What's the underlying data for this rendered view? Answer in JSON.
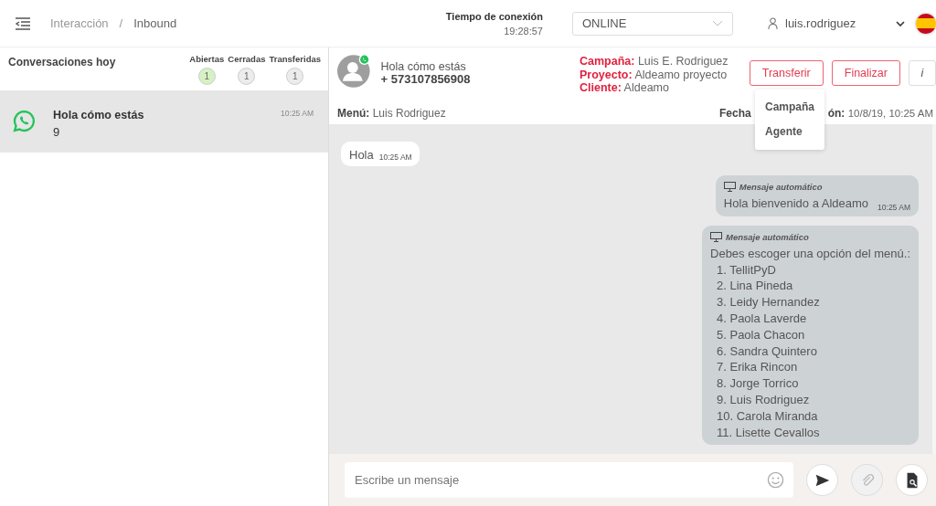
{
  "breadcrumb": [
    "Interacción",
    "/",
    "Inbound"
  ],
  "connection": {
    "label": "Tiempo de conexión",
    "time": "19:28:57"
  },
  "status_select": {
    "value": "ONLINE"
  },
  "user": {
    "name": "luis.rodriguez"
  },
  "conversations": {
    "title": "Conversaciones hoy",
    "counters": [
      {
        "label": "Abiertas",
        "count": "1",
        "color": "#d6f2c4"
      },
      {
        "label": "Cerradas",
        "count": "1",
        "color": "#ececec"
      },
      {
        "label": "Transferidas",
        "count": "1",
        "color": "#ececec"
      }
    ],
    "items": [
      {
        "title": "Hola cómo estás",
        "subtitle": "9",
        "time": "10:25 AM",
        "selected": true
      }
    ]
  },
  "contact": {
    "name": "Hola cómo estás",
    "phone": "+ 573107856908"
  },
  "details": [
    {
      "label": "Campaña:",
      "value": "Luis E. Rodriguez"
    },
    {
      "label": "Proyecto:",
      "value": "Aldeamo proyecto"
    },
    {
      "label": "Cliente:",
      "value": "Aldeamo"
    }
  ],
  "actions": [
    {
      "label": "Transferir",
      "kind": "outline"
    },
    {
      "label": "Finalizar",
      "kind": "outline"
    },
    {
      "label": "i",
      "kind": "info"
    }
  ],
  "transfer_menu": [
    "Campaña",
    "Agente"
  ],
  "menu_line": {
    "label": "Menú:",
    "value": "Luis Rodriguez"
  },
  "date_line": {
    "label_start": "Fecha",
    "label_end": "ón:",
    "value": "10/8/19, 10:25 AM"
  },
  "messages": [
    {
      "kind": "incoming",
      "text": "Hola",
      "time": "10:25 AM"
    },
    {
      "kind": "auto",
      "header": "Mensaje automático",
      "text": "Hola bienvenido a Aldeamo",
      "time": "10:25 AM"
    },
    {
      "kind": "auto",
      "header": "Mensaje automático",
      "text": "Debes escoger una opción del menú.:",
      "options": [
        "1. TellitPyD",
        "2. Lina Pineda",
        "3. Leidy Hernandez",
        "4. Paola Laverde",
        "5. Paola Chacon",
        "6. Sandra Quintero",
        "7. Erika Rincon",
        "8. Jorge Torrico",
        "9. Luis Rodriguez",
        "10. Carola Miranda",
        "11. Lisette Cevallos"
      ]
    }
  ],
  "composer": {
    "placeholder": "Escribe un mensaje"
  }
}
